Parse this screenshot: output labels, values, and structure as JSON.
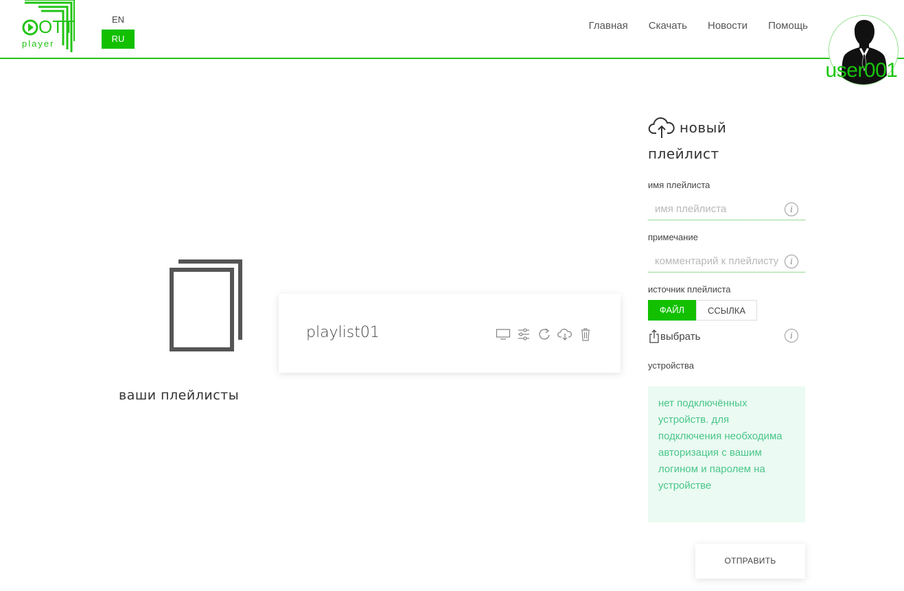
{
  "header": {
    "logo": {
      "brand_text": "OTT",
      "sub_text": "player"
    },
    "languages": [
      {
        "code": "EN",
        "active": false
      },
      {
        "code": "RU",
        "active": true
      }
    ],
    "nav": [
      {
        "label": "Главная"
      },
      {
        "label": "Скачать"
      },
      {
        "label": "Новости"
      },
      {
        "label": "Помощь"
      }
    ],
    "user": {
      "name": "user001",
      "avatar_icon": "user-silhouette-icon"
    }
  },
  "playlists": {
    "caption": "ваши плейлисты",
    "icon": "playlists-icon",
    "items": [
      {
        "name": "playlist01",
        "actions": [
          "tv-icon",
          "settings-sliders-icon",
          "refresh-icon",
          "cloud-download-icon",
          "trash-icon"
        ]
      }
    ]
  },
  "new_playlist": {
    "title_line1": "новый",
    "title_line2": "плейлист",
    "name_label": "имя плейлиста",
    "name_placeholder": "имя плейлиста",
    "note_label": "примечание",
    "note_placeholder": "комментарий к плейлисту",
    "source_label": "источник плейлиста",
    "source_file": "ФАЙЛ",
    "source_link": "ССЫЛКА",
    "choose_label": "выбрать",
    "devices_label": "устройства",
    "devices_message": "нет подключённых устройств. для подключения необходима авторизация с вашим логином и паролем на устройстве",
    "submit_label": "ОТПРАВИТЬ"
  },
  "colors": {
    "accent": "#12c000",
    "divider": "#22c414",
    "devices_bg": "#ebfaf2",
    "devices_text": "#4ac68a"
  }
}
